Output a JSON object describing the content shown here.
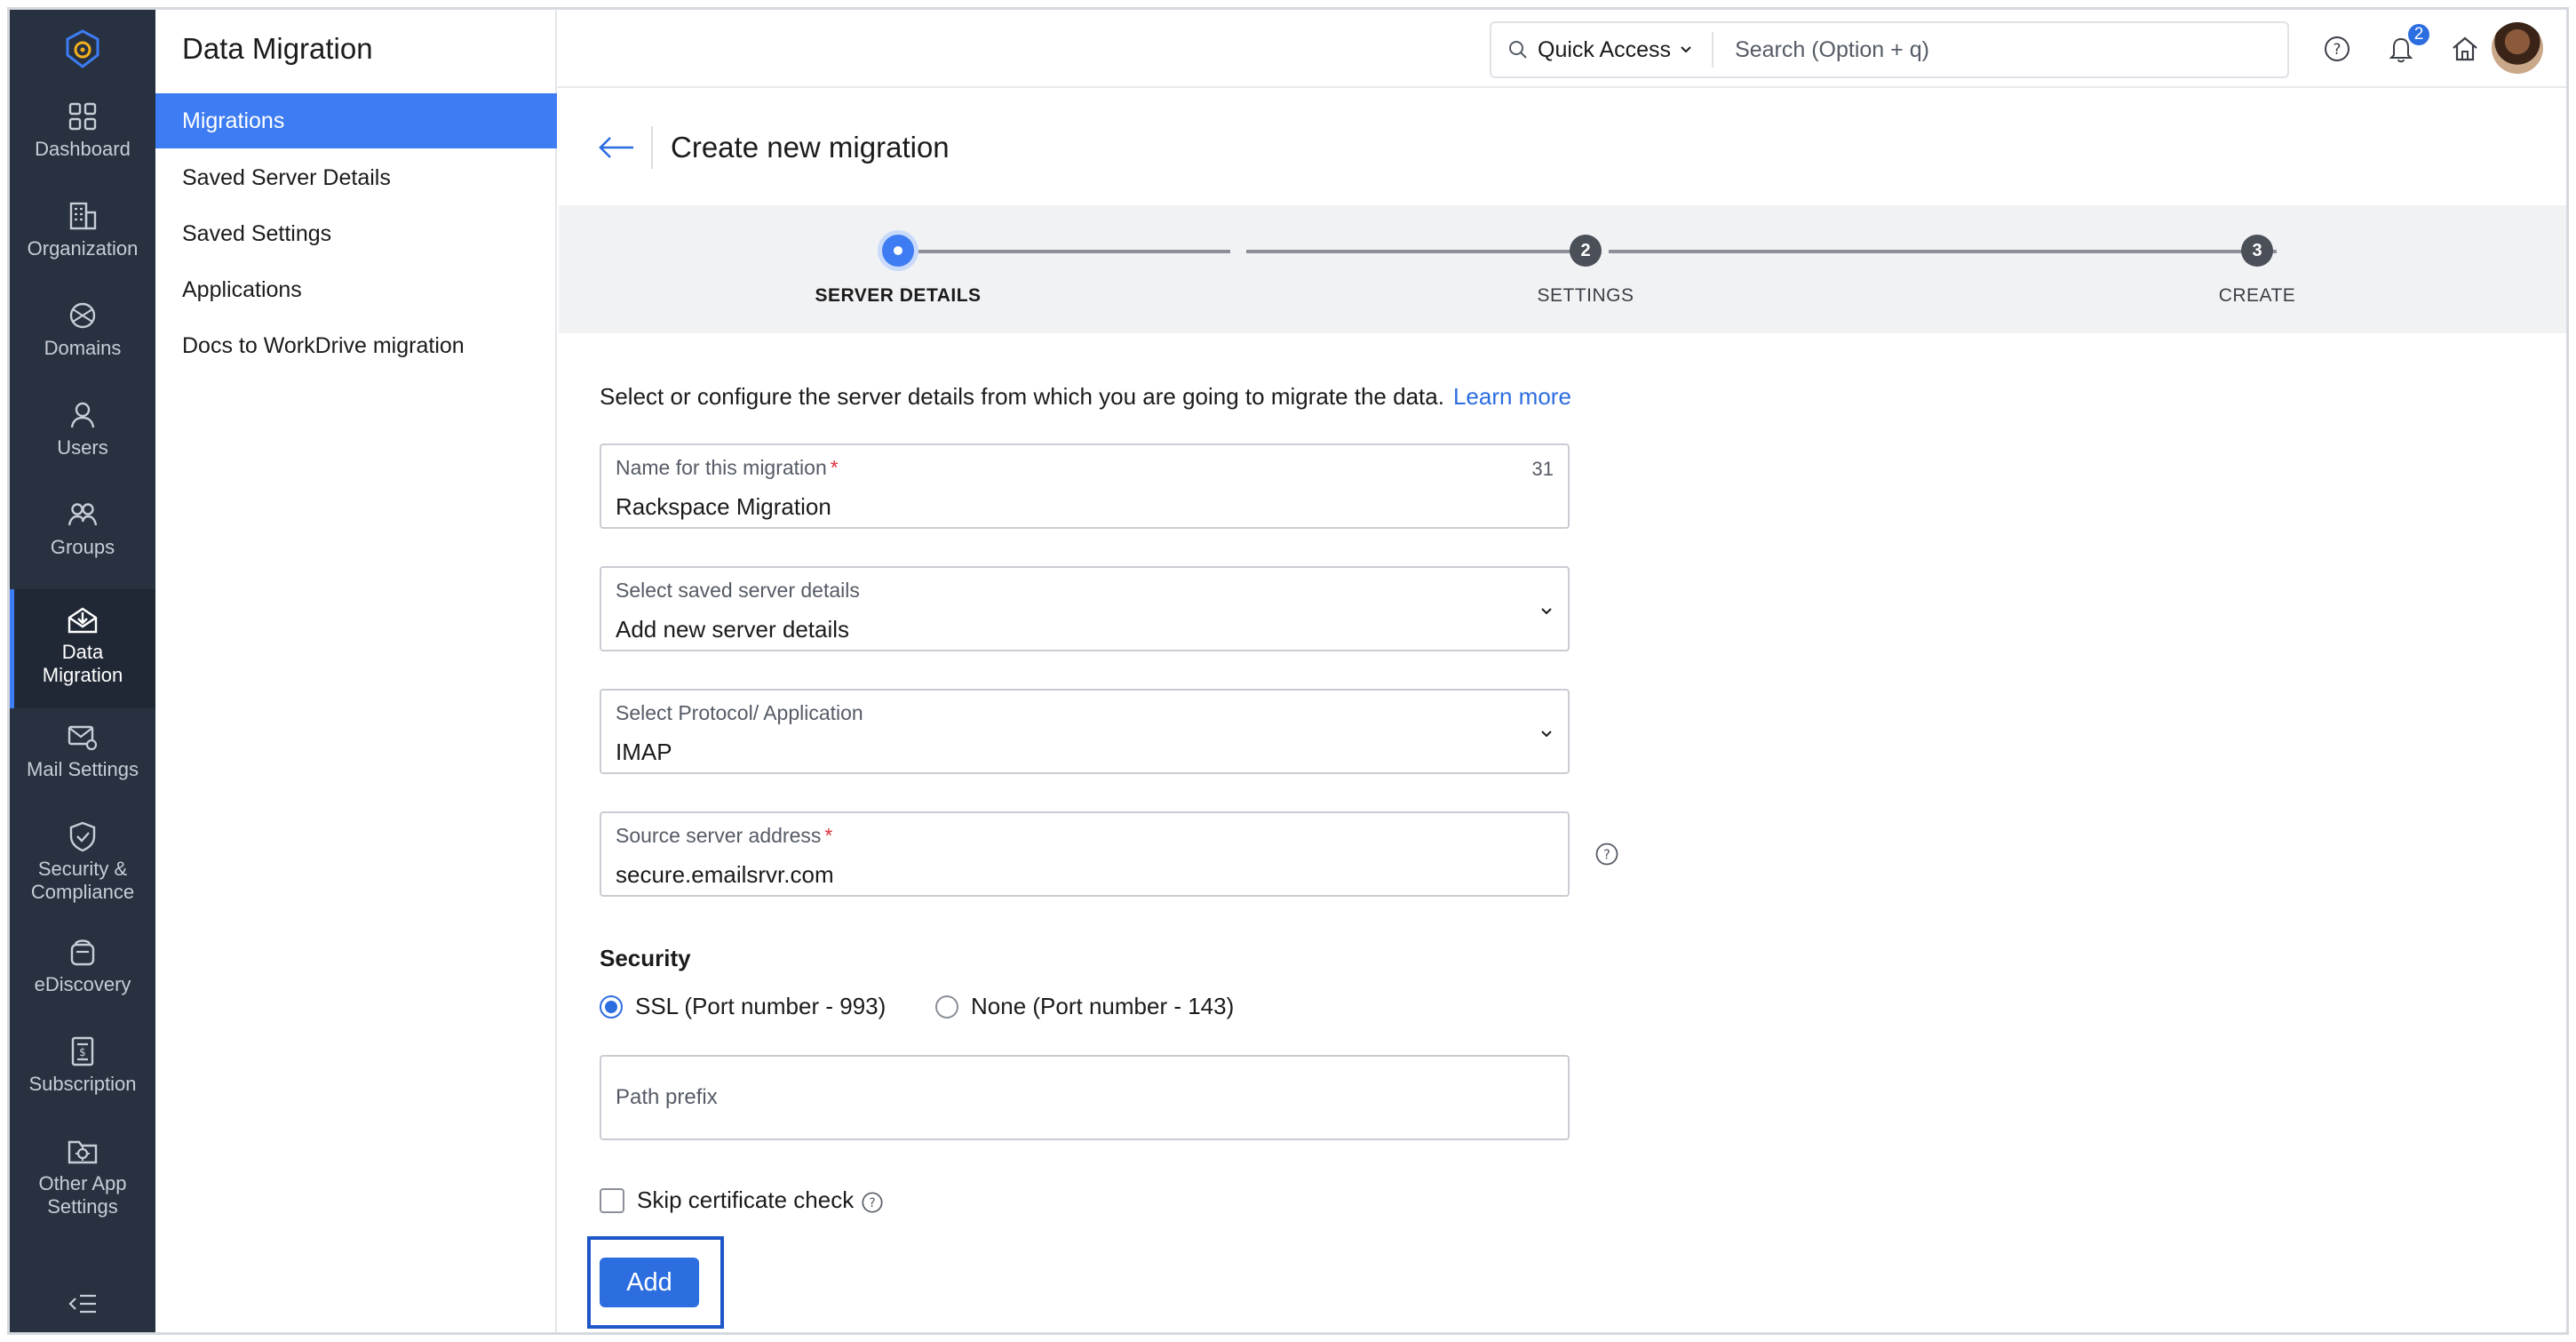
{
  "app": {
    "section_title": "Data Migration"
  },
  "rail": {
    "items": [
      {
        "label": "Dashboard",
        "icon": "dashboard-icon"
      },
      {
        "label": "Organization",
        "icon": "organization-icon"
      },
      {
        "label": "Domains",
        "icon": "globe-icon"
      },
      {
        "label": "Users",
        "icon": "user-icon"
      },
      {
        "label": "Groups",
        "icon": "groups-icon"
      },
      {
        "label": "Data Migration",
        "icon": "data-migration-icon",
        "active": true
      },
      {
        "label": "Mail Settings",
        "icon": "mail-settings-icon"
      },
      {
        "label": "Security & Compliance",
        "icon": "shield-check-icon"
      },
      {
        "label": "eDiscovery",
        "icon": "ediscovery-icon"
      },
      {
        "label": "Subscription",
        "icon": "subscription-icon"
      },
      {
        "label": "Other App Settings",
        "icon": "app-settings-icon"
      }
    ]
  },
  "submenu": {
    "items": [
      {
        "label": "Migrations",
        "active": true
      },
      {
        "label": "Saved Server Details"
      },
      {
        "label": "Saved Settings"
      },
      {
        "label": "Applications"
      },
      {
        "label": "Docs to WorkDrive migration"
      }
    ]
  },
  "header": {
    "quick_access_label": "Quick Access",
    "search_placeholder": "Search (Option + q)",
    "notification_count": "2"
  },
  "page": {
    "title": "Create new migration"
  },
  "stepper": {
    "steps": [
      {
        "number": "",
        "label": "SERVER DETAILS",
        "state": "active"
      },
      {
        "number": "2",
        "label": "SETTINGS",
        "state": "pending"
      },
      {
        "number": "3",
        "label": "CREATE",
        "state": "pending"
      }
    ]
  },
  "form": {
    "intro_text": "Select or configure the server details from which you are going to migrate the data.",
    "learn_more": "Learn more",
    "name_field": {
      "label": "Name for this migration",
      "required_mark": "*",
      "value": "Rackspace Migration",
      "remaining_chars": "31"
    },
    "saved_server": {
      "label": "Select saved server details",
      "value": "Add new server details"
    },
    "protocol": {
      "label": "Select Protocol/ Application",
      "value": "IMAP"
    },
    "source_server": {
      "label": "Source server address",
      "required_mark": "*",
      "value": "secure.emailsrvr.com"
    },
    "security": {
      "title": "Security",
      "options": [
        {
          "label": "SSL (Port number - 993)",
          "selected": true
        },
        {
          "label": "None (Port number - 143)",
          "selected": false
        }
      ]
    },
    "path_prefix": {
      "placeholder": "Path prefix"
    },
    "skip_cert": {
      "label": "Skip certificate check",
      "checked": false
    },
    "add_button": "Add"
  },
  "colors": {
    "accent": "#3d7cf2",
    "rail_bg": "#283140",
    "required": "#e0323c"
  }
}
